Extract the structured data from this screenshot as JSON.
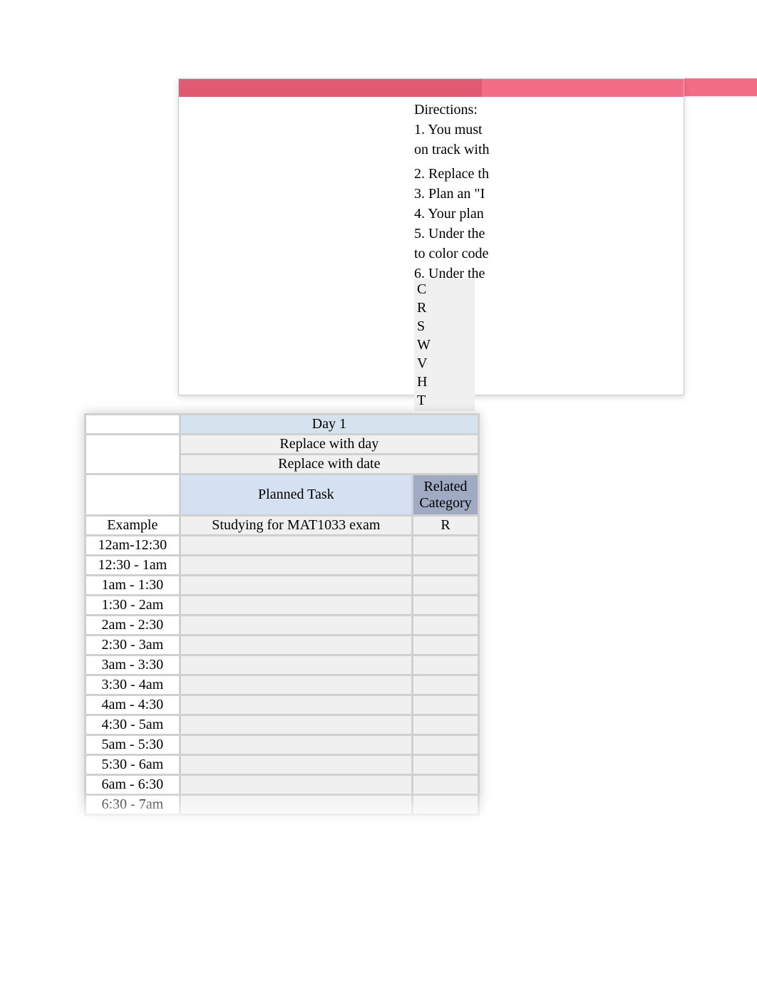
{
  "directions": {
    "title": "Directions:",
    "items": [
      "1. You must",
      "on track with",
      "2. Replace th",
      "3. Plan an \"I",
      "4. Your plan",
      "5. Under the",
      "to color code",
      "6. Under the"
    ]
  },
  "legend": {
    "codes": [
      "C",
      "R",
      "S",
      "W",
      "V",
      "H",
      "T"
    ]
  },
  "schedule": {
    "day_label": "Day 1",
    "replace_day": "Replace with day",
    "replace_date": "Replace with date",
    "planned_task_header": "Planned Task",
    "category_header": "Related Category",
    "example": {
      "label": "Example",
      "task": "Studying for MAT1033 exam",
      "category": "R"
    },
    "time_slots": [
      "12am-12:30",
      "12:30 - 1am",
      "1am - 1:30",
      "1:30 - 2am",
      "2am - 2:30",
      "2:30 - 3am",
      "3am - 3:30",
      "3:30 - 4am",
      "4am - 4:30",
      "4:30 - 5am",
      "5am - 5:30",
      "5:30 - 6am",
      "6am - 6:30",
      "6:30 - 7am"
    ]
  }
}
